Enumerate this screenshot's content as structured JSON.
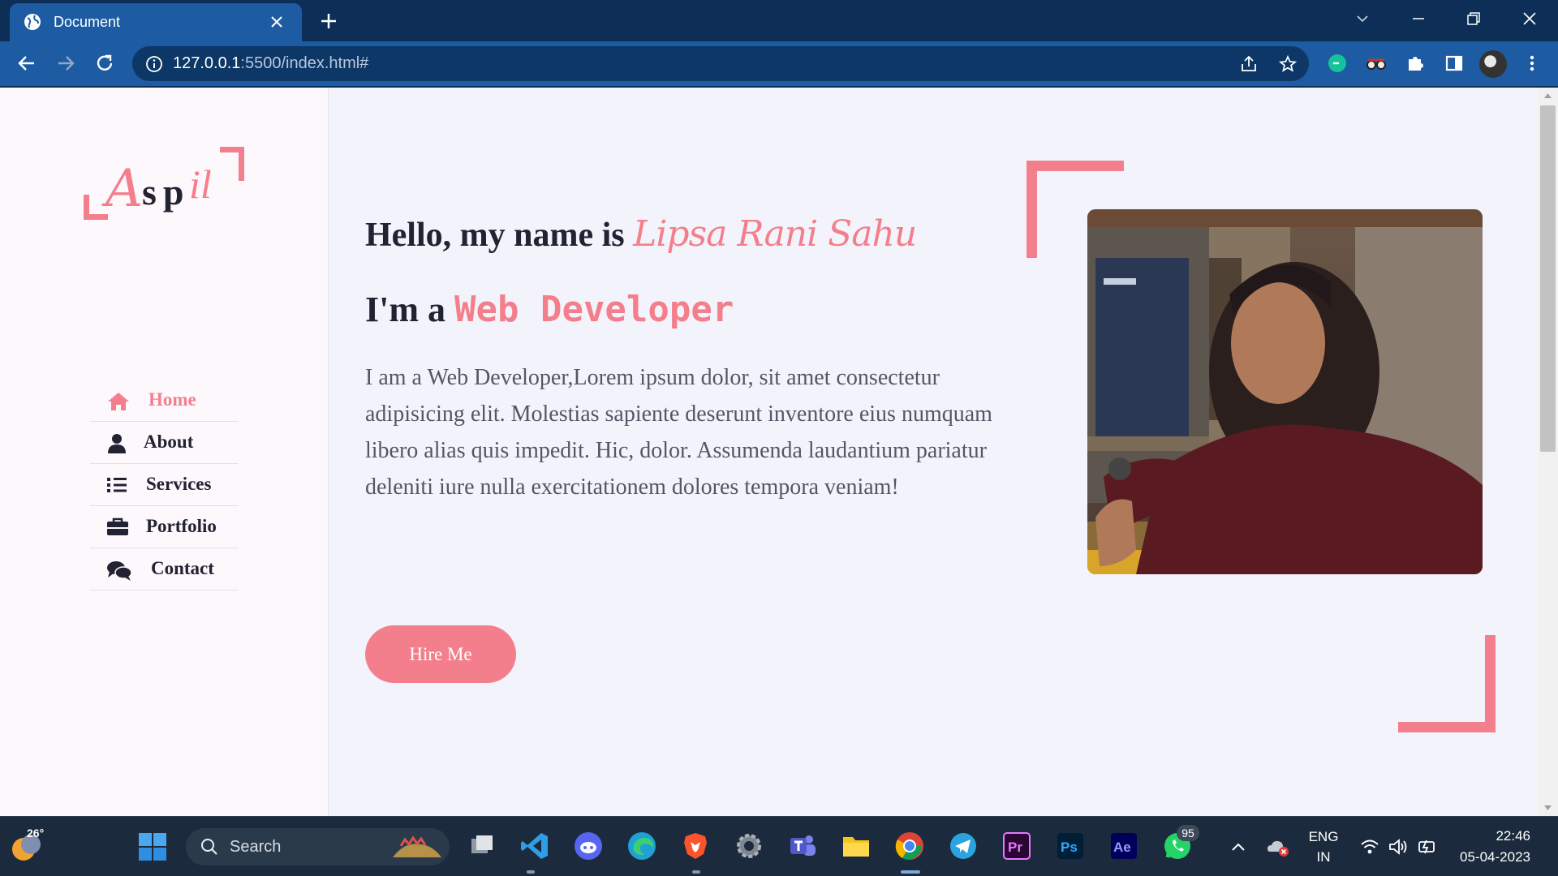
{
  "browser": {
    "tab_title": "Document",
    "url_host": "127.0.0.1",
    "url_rest": ":5500/index.html#"
  },
  "sidebar": {
    "logo": {
      "a": "A",
      "sp": "sp",
      "il": "il"
    },
    "nav": [
      {
        "label": "Home",
        "icon": "home-icon",
        "active": true
      },
      {
        "label": "About",
        "icon": "user-icon",
        "active": false
      },
      {
        "label": "Services",
        "icon": "list-icon",
        "active": false
      },
      {
        "label": "Portfolio",
        "icon": "briefcase-icon",
        "active": false
      },
      {
        "label": "Contact",
        "icon": "comments-icon",
        "active": false
      }
    ]
  },
  "hero": {
    "greeting": "Hello, my name is",
    "name": "Lipsa Rani Sahu",
    "role_prefix": "I'm a",
    "role": "Web Developer",
    "description": "I am a Web Developer,Lorem ipsum dolor, sit amet consectetur adipisicing elit. Molestias sapiente deserunt inventore eius numquam libero alias quis impedit. Hic, dolor. Assumenda laudantium pariatur deleniti iure nulla exercitationem dolores tempora veniam!",
    "hire_button": "Hire Me"
  },
  "taskbar": {
    "weather_temp": "26°",
    "search_label": "Search",
    "whatsapp_badge": "95",
    "lang_top": "ENG",
    "lang_bottom": "IN",
    "time": "22:46",
    "date": "05-04-2023"
  },
  "colors": {
    "accent": "#f47f8c",
    "browser_dark": "#0c2e57",
    "browser_tab": "#1d5ca3"
  }
}
